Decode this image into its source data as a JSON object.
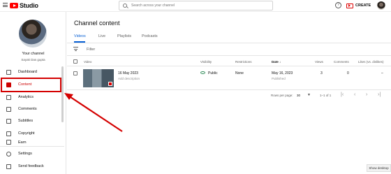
{
  "header": {
    "logo_text": "Studio",
    "search_placeholder": "Search across your channel",
    "help_label": "?",
    "create_label": "CREATE"
  },
  "sidebar": {
    "channel_label": "Your channel",
    "channel_name": "Sayak Das gupta",
    "items": [
      {
        "label": "Dashboard",
        "icon": "dashboard-icon"
      },
      {
        "label": "Content",
        "icon": "content-icon"
      },
      {
        "label": "Analytics",
        "icon": "analytics-icon"
      },
      {
        "label": "Comments",
        "icon": "comments-icon"
      },
      {
        "label": "Subtitles",
        "icon": "subtitles-icon"
      },
      {
        "label": "Copyright",
        "icon": "copyright-icon"
      },
      {
        "label": "Earn",
        "icon": "earn-icon"
      }
    ],
    "bottom": [
      {
        "label": "Settings",
        "icon": "settings-icon"
      },
      {
        "label": "Send feedback",
        "icon": "feedback-icon"
      }
    ]
  },
  "main": {
    "title": "Channel content",
    "tabs": [
      "Videos",
      "Live",
      "Playlists",
      "Podcasts"
    ],
    "filter_label": "Filter",
    "columns": {
      "video": "Video",
      "visibility": "Visibility",
      "restrictions": "Restrictions",
      "date": "Date ↓",
      "views": "Views",
      "comments": "Comments",
      "likes": "Likes (vs. dislikes)"
    },
    "rows": [
      {
        "title": "16 May 2023",
        "description": "Add description",
        "visibility": "Public",
        "restrictions": "None",
        "date": "May 16, 2023",
        "status": "Published",
        "views": "3",
        "comments": "0",
        "likes": "–"
      }
    ],
    "pager": {
      "rows_label": "Rows per page:",
      "rows_value": "30",
      "range": "1–1 of 1"
    }
  },
  "show_desktop": "Show desktop",
  "colors": {
    "accent": "#065fd4",
    "brand": "#ff0000",
    "annotation": "#d40000"
  }
}
